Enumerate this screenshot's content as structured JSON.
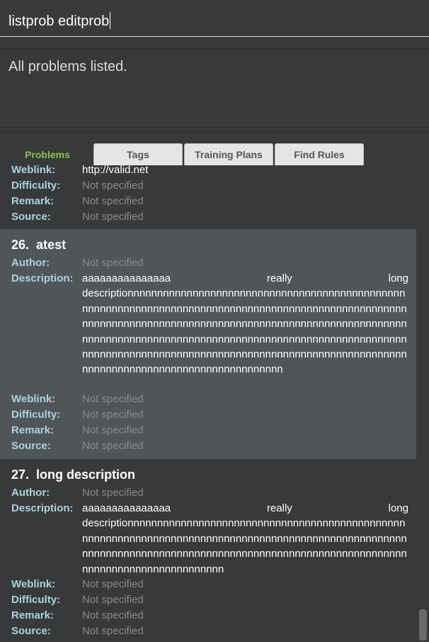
{
  "command_box": {
    "value": "listprob editprob"
  },
  "result_display": {
    "text": "All problems listed."
  },
  "tabs": [
    {
      "label": "Problems",
      "active": true
    },
    {
      "label": "Tags",
      "active": false
    },
    {
      "label": "Training Plans",
      "active": false
    },
    {
      "label": "Find Rules",
      "active": false
    }
  ],
  "labels": {
    "weblink": "Weblink:",
    "difficulty": "Difficulty:",
    "remark": "Remark:",
    "source": "Source:",
    "author": "Author:",
    "description": "Description:"
  },
  "problems": [
    {
      "weblink": "http://valid.net",
      "difficulty": "Not specified",
      "remark": "Not specified",
      "source": "Not specified"
    },
    {
      "index": "26.",
      "name": "atest",
      "author": "Not specified",
      "description_words": [
        "aaaaaaaaaaaaaaa",
        "really",
        "long"
      ],
      "description_rest": "descriptionnnnnnnnnnnnnnnnnnnnnnnnnnnnnnnnnnnnnnnnnnnnnnnnnnnnnnnnnnnnnnnnnnnnnnnnnnnnnnnnnnnnnnnnnnnnnnnnnnnnnnnnnnnnnnnnnnnnnnnnnnnnnnnnnnnnnnnnnnnnnnnnnnnnnnnnnnnnnnnnnnnnnnnnnnnnnnnnnnnnnnnnnnnnnnnnnnnnnnnnnnnnnnnnnnnnnnnnnnnnnnnnnnnnnnnnnnnnnnnnnnnnnnnnnnnnnnnnnnnnnnnnnnnnnnnnnnnnnnnnnnnnnnnnnnnnnnnnnnnnn",
      "weblink": "Not specified",
      "difficulty": "Not specified",
      "remark": "Not specified",
      "source": "Not specified"
    },
    {
      "index": "27.",
      "name": "long description",
      "author": "Not specified",
      "description_words": [
        "aaaaaaaaaaaaaaa",
        "really",
        "long"
      ],
      "description_rest": "descriptionnnnnnnnnnnnnnnnnnnnnnnnnnnnnnnnnnnnnnnnnnnnnnnnnnnnnnnnnnnnnnnnnnnnnnnnnnnnnnnnnnnnnnnnnnnnnnnnnnnnnnnnnnnnnnnnnnnnnnnnnnnnnnnnnnnnnnnnnnnnnnnnnnnnnnnnnnnnnnnnnnnnnnnnnnnnnnnnnnnnn",
      "weblink": "Not specified",
      "difficulty": "Not specified",
      "remark": "Not specified",
      "source": "Not specified"
    }
  ]
}
